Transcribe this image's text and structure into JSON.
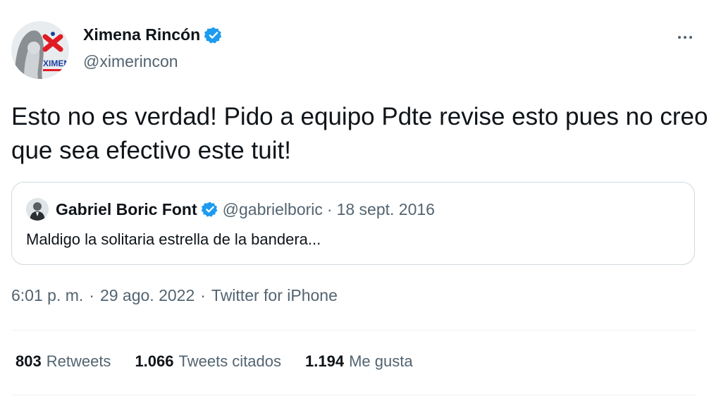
{
  "tweet": {
    "author_name": "Ximena Rincón",
    "author_handle": "@ximerincon",
    "avatar_logo_text": "XIMENA",
    "text": "Esto no es verdad! Pido a equipo Pdte revise esto pues no creo que sea efectivo este tuit!",
    "time": "6:01 p. m.",
    "date": "29 ago. 2022",
    "source": "Twitter for iPhone",
    "separator": "·"
  },
  "quoted": {
    "author_name": "Gabriel Boric Font",
    "author_handle": "@gabrielboric",
    "separator": "·",
    "date": "18 sept. 2016",
    "text": "Maldigo la solitaria estrella de la bandera..."
  },
  "stats": {
    "retweets_count": "803",
    "retweets_label": "Retweets",
    "quotes_count": "1.066",
    "quotes_label": "Tweets citados",
    "likes_count": "1.194",
    "likes_label": "Me gusta"
  },
  "colors": {
    "verified_blue": "#1d9bf0",
    "logo_red": "#e01b24",
    "logo_blue": "#1a3fa0",
    "secondary_text": "#536471"
  },
  "icons": {
    "verified": "verified-badge-icon",
    "more": "more-horizontal-icon"
  }
}
